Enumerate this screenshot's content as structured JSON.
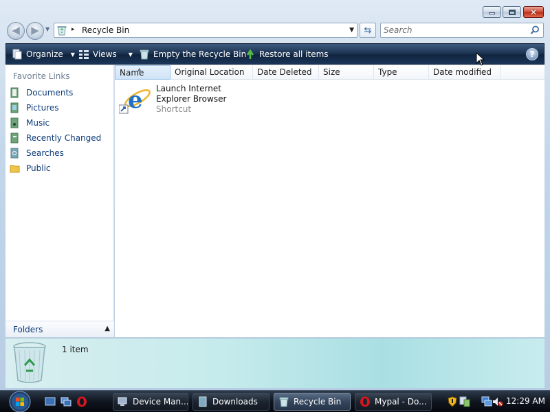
{
  "window": {
    "title_controls": {
      "minimize": "minimize",
      "maximize": "maximize",
      "close": "✕"
    }
  },
  "address_bar": {
    "path": "Recycle Bin",
    "separator": "▸"
  },
  "search": {
    "placeholder": "Search"
  },
  "command_bar": {
    "organize": "Organize",
    "views": "Views",
    "empty": "Empty the Recycle Bin",
    "restore": "Restore all items",
    "help": "?"
  },
  "nav_pane": {
    "heading": "Favorite Links",
    "items": [
      {
        "label": "Documents",
        "icon": "documents-icon"
      },
      {
        "label": "Pictures",
        "icon": "pictures-icon"
      },
      {
        "label": "Music",
        "icon": "music-icon"
      },
      {
        "label": "Recently Changed",
        "icon": "recently-changed-icon"
      },
      {
        "label": "Searches",
        "icon": "searches-icon"
      },
      {
        "label": "Public",
        "icon": "public-folder-icon"
      }
    ],
    "folders_label": "Folders"
  },
  "columns": [
    "Name",
    "Original Location",
    "Date Deleted",
    "Size",
    "Type",
    "Date modified"
  ],
  "files": [
    {
      "name": "Launch Internet Explorer Browser",
      "type": "Shortcut",
      "icon": "internet-explorer-icon"
    }
  ],
  "details": {
    "count": "1 item"
  },
  "taskbar": {
    "tasks": [
      {
        "label": "Device Man...",
        "icon": "device-manager-icon"
      },
      {
        "label": "Downloads",
        "icon": "folder-icon"
      },
      {
        "label": "Recycle Bin",
        "icon": "recycle-bin-icon",
        "active": true
      },
      {
        "label": "Mypal - Do...",
        "icon": "opera-icon"
      }
    ],
    "clock": "12:29 AM"
  },
  "colors": {
    "command_bar": "#1e3655",
    "nav_link": "#0e3c7a",
    "details_pane": "#c6ebec",
    "taskbar": "#10161f"
  }
}
